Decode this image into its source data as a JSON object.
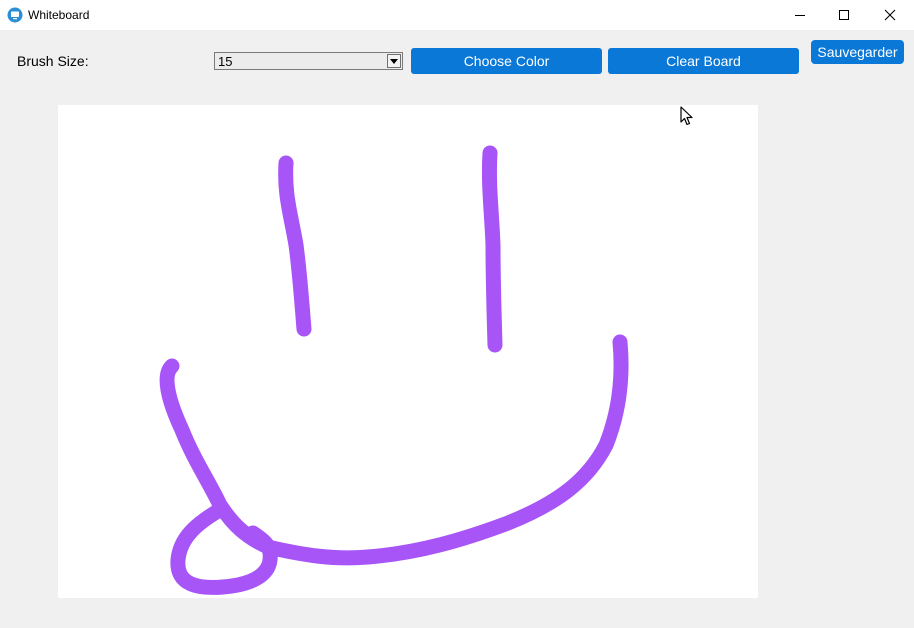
{
  "window": {
    "title": "Whiteboard",
    "controls": [
      "minimize-icon",
      "maximize-icon",
      "close-icon"
    ]
  },
  "toolbar": {
    "brush_size_label": "Brush Size:",
    "brush_size_value": "15",
    "choose_color_label": "Choose Color",
    "clear_board_label": "Clear Board",
    "save_label": "Sauvegarder"
  },
  "colors": {
    "accent": "#0a78d7",
    "stroke": "#a855f7",
    "canvas": "#ffffff",
    "background": "#f0f0f0"
  },
  "canvas": {
    "strokes": 4,
    "content": "freehand drawing"
  }
}
